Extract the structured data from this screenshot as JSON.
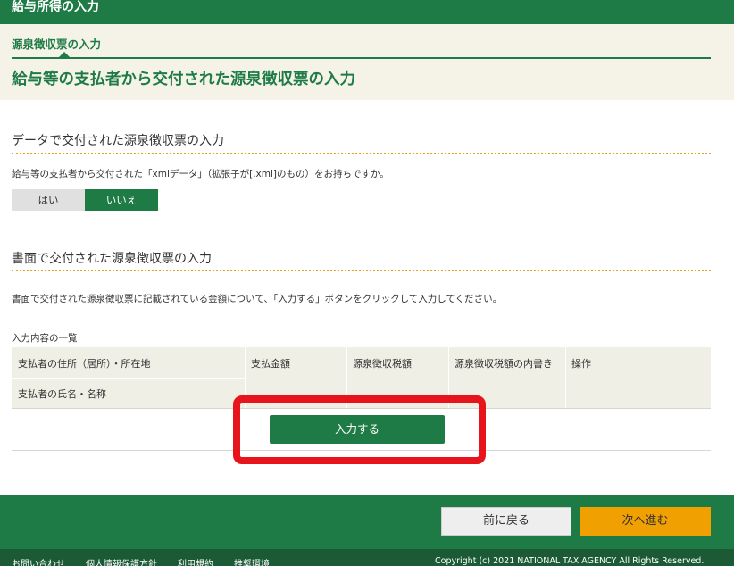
{
  "top_bar": {
    "title": "給与所得の入力"
  },
  "header": {
    "breadcrumb": "源泉徴収票の入力",
    "page_title": "給与等の支払者から交付された源泉徴収票の入力"
  },
  "section_data": {
    "title": "データで交付された源泉徴収票の入力",
    "question": "給与等の支払者から交付された「xmlデータ」（拡張子が[.xml]のもの）をお持ちですか。",
    "yes_label": "はい",
    "no_label": "いいえ",
    "selected": "いいえ"
  },
  "section_paper": {
    "title": "書面で交付された源泉徴収票の入力",
    "instruction": "書面で交付された源泉徴収票に記載されている金額について、「入力する」ボタンをクリックして入力してください。",
    "list_label": "入力内容の一覧",
    "table_headers": {
      "payer_address": "支払者の住所（居所）・所在地",
      "payer_name": "支払者の氏名・名称",
      "payment_amount": "支払金額",
      "withholding_tax": "源泉徴収税額",
      "withholding_breakdown": "源泉徴収税額の内書き",
      "operation": "操作"
    },
    "input_button": "入力する"
  },
  "nav": {
    "back_label": "前に戻る",
    "next_label": "次へ進む"
  },
  "footer": {
    "links": [
      "お問い合わせ",
      "個人情報保護方針",
      "利用規約",
      "推奨環境"
    ],
    "copyright": "Copyright (c) 2021 NATIONAL TAX AGENCY All Rights Reserved."
  },
  "colors": {
    "brand_green": "#1e7b45",
    "accent_orange": "#f0a000",
    "highlight_red": "#e8141b"
  }
}
